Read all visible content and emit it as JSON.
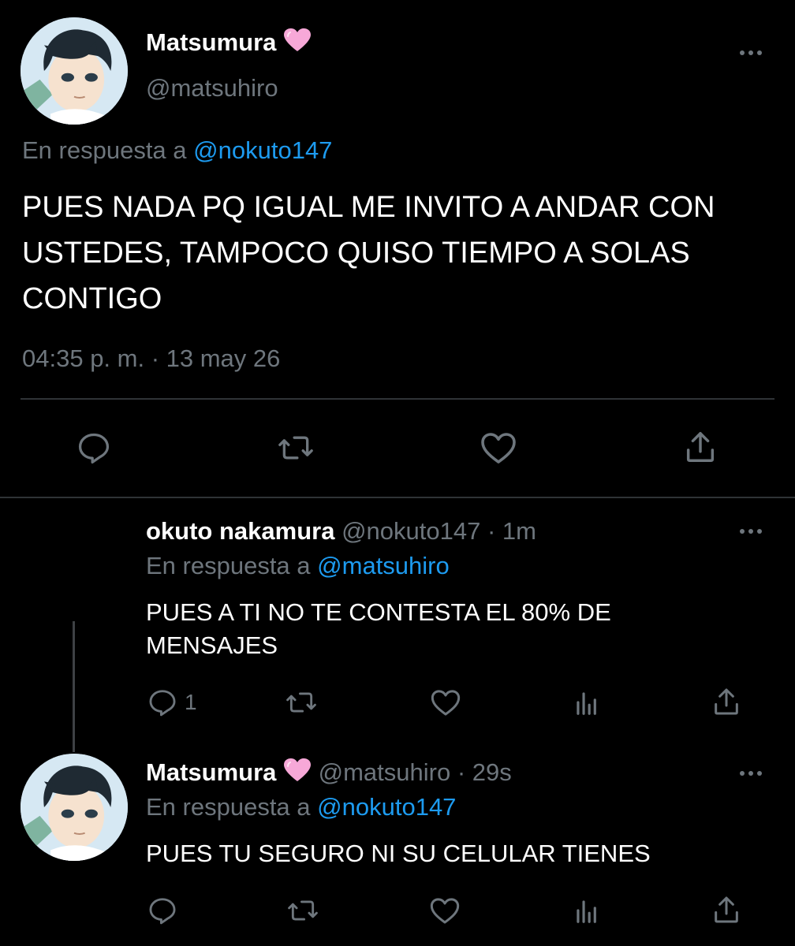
{
  "main_tweet": {
    "display_name": "Matsumura",
    "handle": "@matsuhiro",
    "reply_prefix": "En respuesta a",
    "reply_to": "@nokuto147",
    "text": "PUES NADA PQ IGUAL ME INVITO A ANDAR CON USTEDES, TAMPOCO QUISO TIEMPO A SOLAS CONTIGO",
    "timestamp": "04:35 p. m. · 13 may 26"
  },
  "reply1": {
    "display_name": "okuto nakamura",
    "handle": "@nokuto147",
    "time": "· 1m",
    "reply_prefix": "En respuesta a",
    "reply_to": "@matsuhiro",
    "text": "PUES A TI NO TE CONTESTA EL 80% DE MENSAJES",
    "reply_count": "1"
  },
  "reply2": {
    "display_name": "Matsumura",
    "handle": "@matsuhiro",
    "time": "· 29s",
    "reply_prefix": "En respuesta a",
    "reply_to": "@nokuto147",
    "text": "PUES TU SEGURO NI SU CELULAR TIENES"
  },
  "colors": {
    "background": "#000000",
    "text": "#ffffff",
    "muted": "#6e767d",
    "link": "#1d9bf0",
    "heart_emoji": "#f7a8d8"
  },
  "icons": [
    "reply-icon",
    "retweet-icon",
    "like-icon",
    "share-icon",
    "analytics-icon",
    "more-icon",
    "pink-heart-emoji"
  ]
}
